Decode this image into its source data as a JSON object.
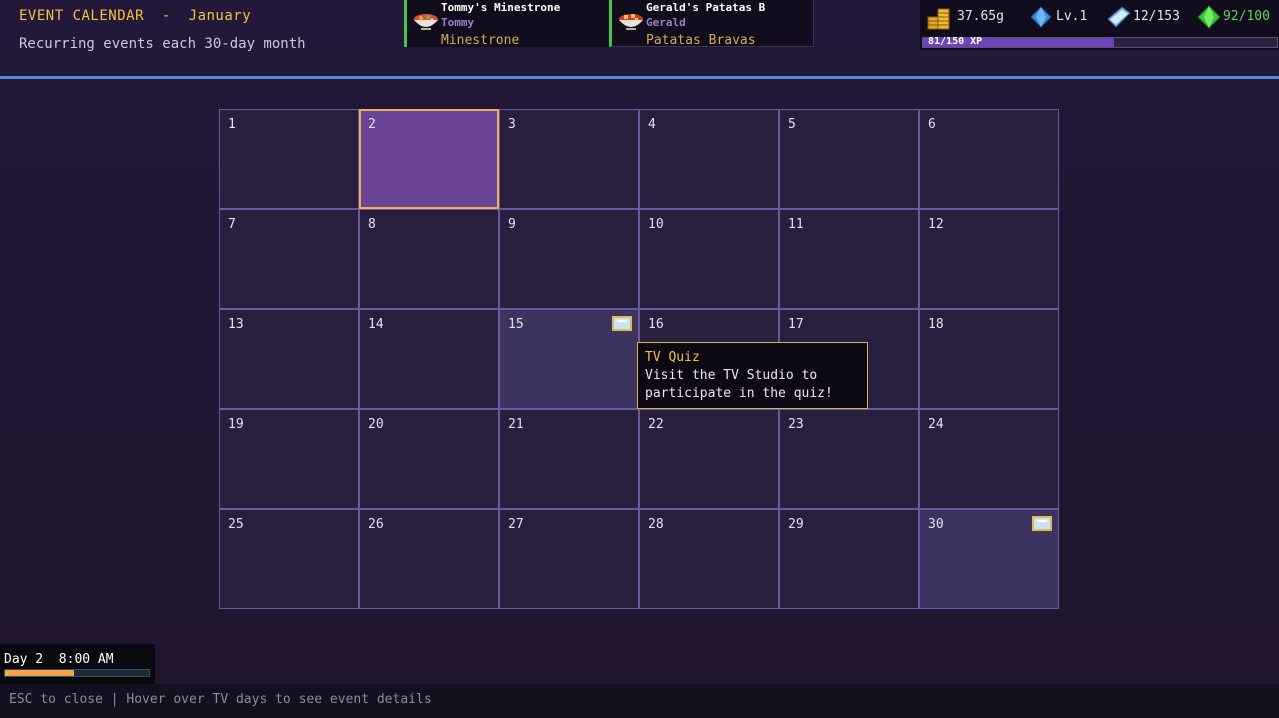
{
  "header": {
    "title": "EVENT CALENDAR  -  January",
    "subtitle": "Recurring events each 30-day month"
  },
  "orders": [
    {
      "title": "Tommy's Minestrone",
      "customer": "Tommy",
      "dish": "Minestrone",
      "icon": "soup-bowl-icon"
    },
    {
      "title": "Gerald's Patatas B",
      "customer": "Gerald",
      "dish": "Patatas Bravas",
      "icon": "patatas-bowl-icon"
    }
  ],
  "stats": {
    "gold": "37.65g",
    "level": "Lv.1",
    "recipes": "12/153",
    "energy": "92/100",
    "xp_text": "81/150 XP",
    "xp_fraction": 0.54
  },
  "calendar": {
    "days": [
      "1",
      "2",
      "3",
      "4",
      "5",
      "6",
      "7",
      "8",
      "9",
      "10",
      "11",
      "12",
      "13",
      "14",
      "15",
      "16",
      "17",
      "18",
      "19",
      "20",
      "21",
      "22",
      "23",
      "24",
      "25",
      "26",
      "27",
      "28",
      "29",
      "30"
    ],
    "today": 2,
    "event_days": [
      15,
      30
    ]
  },
  "tooltip": {
    "title": "TV Quiz",
    "line1": "Visit the TV Studio to",
    "line2": "participate in the quiz!"
  },
  "clock": {
    "text": "Day 2  8:00 AM",
    "progress": 0.48
  },
  "footer": {
    "hint": "ESC to close | Hover over TV days to see event details"
  },
  "colors": {
    "accent_gold": "#f2c23c",
    "today_fill": "#6a4597",
    "today_border": "#f0b050",
    "header_line": "#4a8fdc",
    "order_border": "#43c44c"
  }
}
